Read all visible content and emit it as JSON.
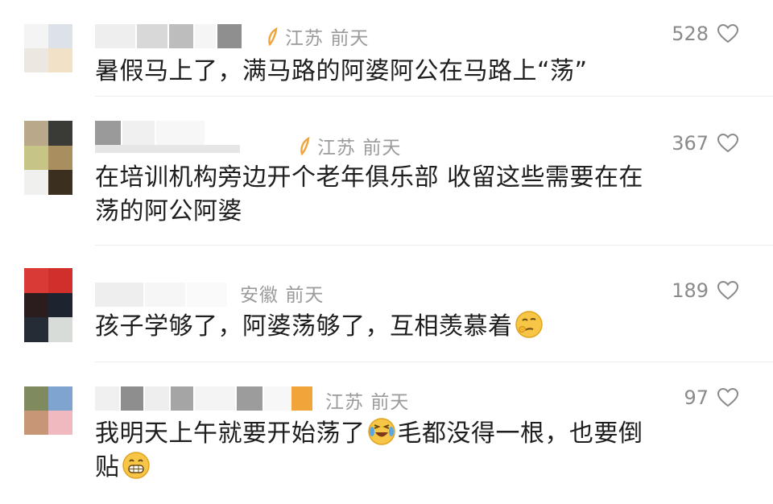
{
  "comments": [
    {
      "location": "江苏",
      "time": "前天",
      "likes": "528",
      "text": "暑假马上了，满马路的阿婆阿公在马路上“荡”",
      "avatar_colors": [
        "#f4f4f4",
        "#dde2e8",
        "#ece7e1",
        "#f1e2c7"
      ]
    },
    {
      "location": "江苏",
      "time": "前天",
      "likes": "367",
      "text_line1": "在培训机构旁边开个老年俱乐部 收留这些需要在在",
      "text_line2": "荡的阿公阿婆",
      "avatar_colors": [
        "#b9a98a",
        "#3a3a36",
        "#c7c586",
        "#a98f5f",
        "#f0f0ee",
        "#3b2f20"
      ]
    },
    {
      "location": "安徽",
      "time": "前天",
      "likes": "189",
      "text": "孩子学够了，阿婆荡够了，互相羡慕着",
      "emoji": "thinking-emoji",
      "avatar_colors": [
        "#d93a36",
        "#d12f2c",
        "#2b1d1d",
        "#1d2430",
        "#252c36",
        "#d7dcd8"
      ]
    },
    {
      "location": "江苏",
      "time": "前天",
      "likes": "97",
      "text_part1": "我明天上午就要开始荡了",
      "emoji1": "laughing-crying-emoji",
      "text_part2": "毛都没得一根，也要倒",
      "text_line2": "贴",
      "emoji2": "grinning-emoji",
      "avatar_colors": [
        "#7f8a5f",
        "#7fa4cf",
        "#c69677",
        "#f0b9bf"
      ]
    }
  ],
  "colors": {
    "meta": "#9b9b9b",
    "text": "#1e1e1e",
    "divider": "#ececec",
    "location_mark": "#f0a43a"
  }
}
